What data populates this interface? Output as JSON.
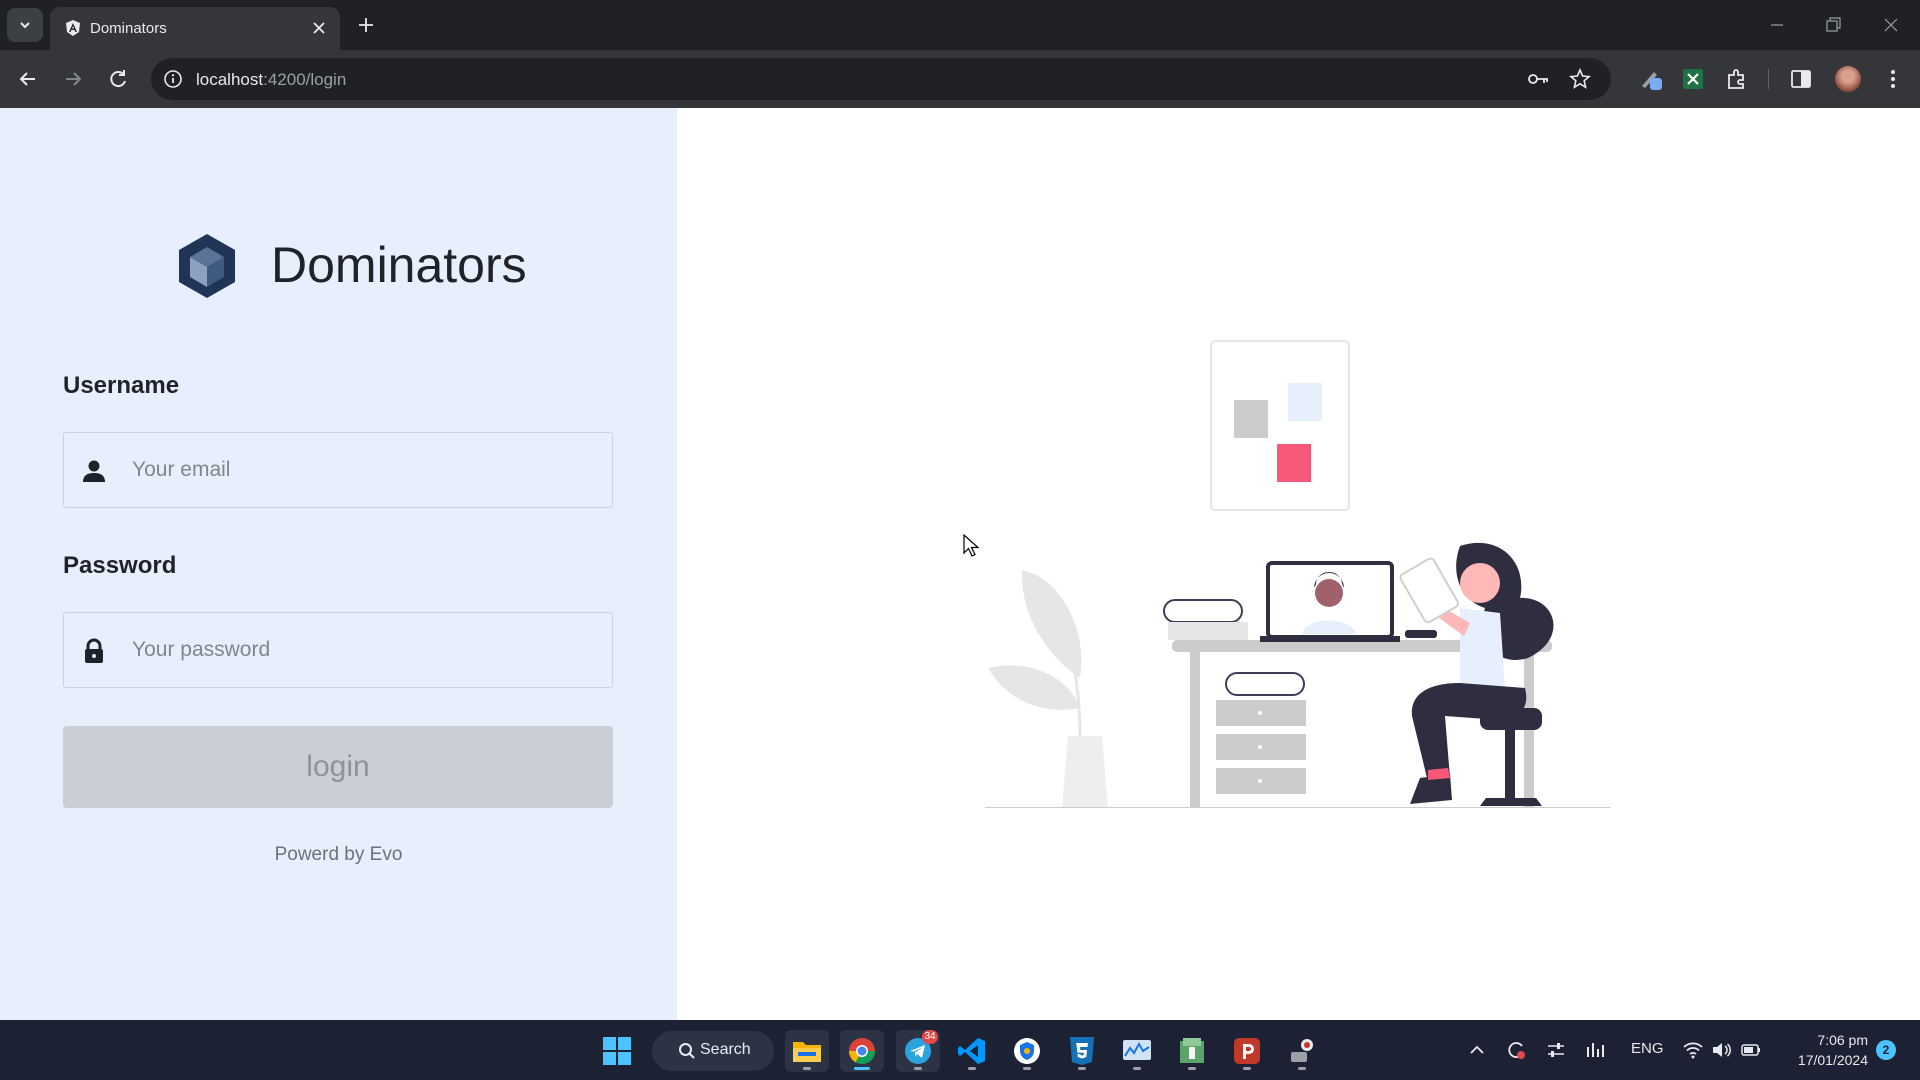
{
  "browser": {
    "tab_title": "Dominators",
    "url_host": "localhost",
    "url_rest": ":4200/login"
  },
  "login": {
    "brand": "Dominators",
    "username_label": "Username",
    "username_placeholder": "Your email",
    "password_label": "Password",
    "password_placeholder": "Your password",
    "submit_label": "login",
    "footer": "Powerd by Evo"
  },
  "taskbar": {
    "search_label": "Search",
    "telegram_badge": "34",
    "language": "ENG",
    "time": "7:06 pm",
    "date": "17/01/2024",
    "notifications": "2"
  },
  "colors": {
    "left_panel_bg": "#e8effc",
    "accent_pink": "#f7587a",
    "logo_dark": "#1e3557",
    "illustration_dark": "#2f2e41"
  }
}
